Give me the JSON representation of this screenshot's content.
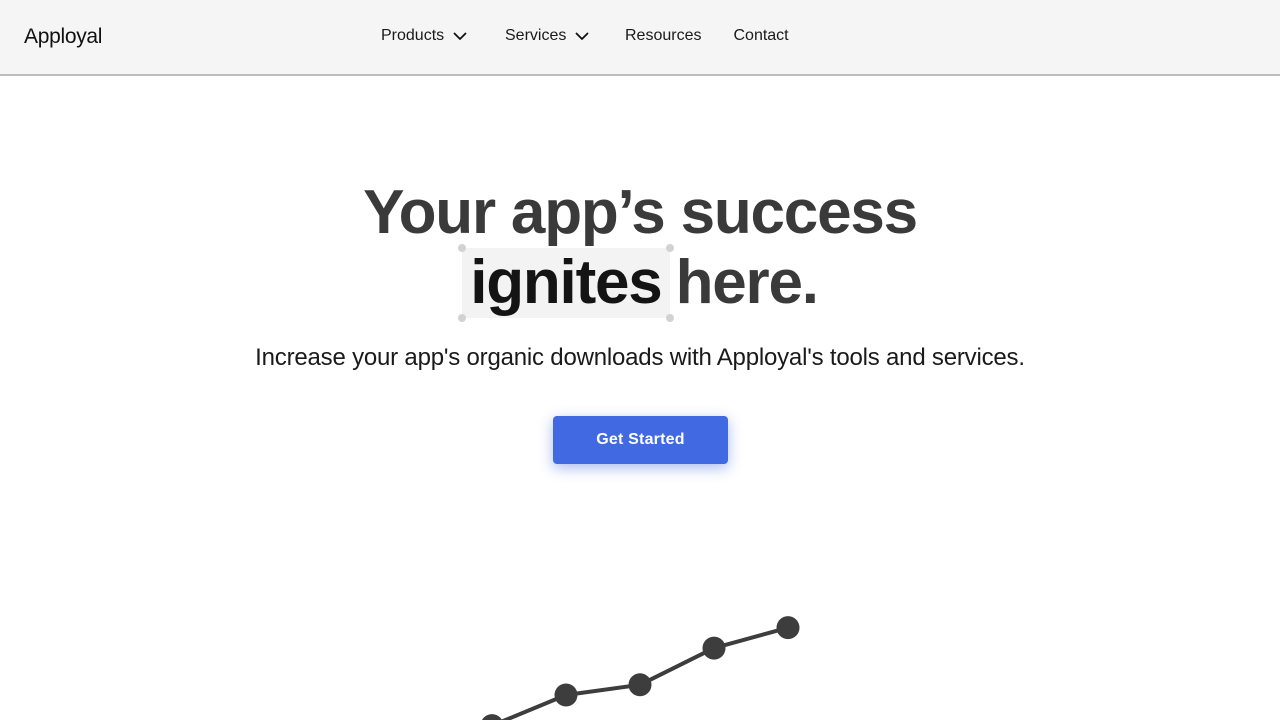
{
  "brand": {
    "name": "Apployal"
  },
  "nav": {
    "items": [
      {
        "label": "Products",
        "has_dropdown": true
      },
      {
        "label": "Services",
        "has_dropdown": true
      },
      {
        "label": "Resources",
        "has_dropdown": false
      },
      {
        "label": "Contact",
        "has_dropdown": false
      }
    ],
    "dropdown_icon": "chevron-down-icon"
  },
  "hero": {
    "title_line1": "Your app’s success",
    "title_highlight": "ignites",
    "title_line2_rest": "here.",
    "subtitle": "Increase your app's organic downloads with Apployal's tools and services.",
    "cta_label": "Get Started"
  },
  "colors": {
    "accent": "#4169e1",
    "heading": "#3a3a3a",
    "nav_bg": "#f5f5f5",
    "chart_line": "#3d3d3d"
  },
  "chart_data": {
    "type": "line",
    "x": [
      1,
      2,
      3,
      4,
      5
    ],
    "values": [
      1.0,
      2.5,
      3.0,
      4.8,
      5.8
    ],
    "ylim": [
      0,
      7
    ],
    "grid": false
  }
}
